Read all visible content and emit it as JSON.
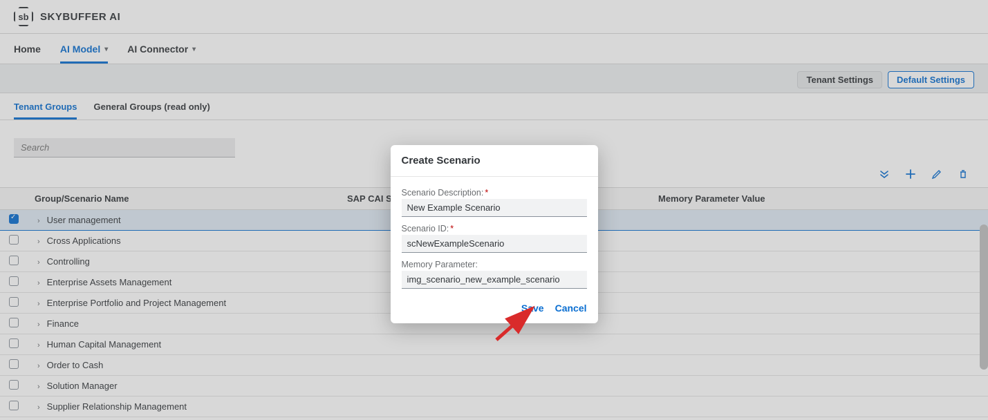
{
  "header": {
    "logo_text": "sb",
    "app_title": "SKYBUFFER AI"
  },
  "nav": {
    "home": "Home",
    "ai_model": "AI Model",
    "ai_connector": "AI Connector"
  },
  "settings_bar": {
    "tenant_settings": "Tenant Settings",
    "default_settings": "Default Settings"
  },
  "subtabs": {
    "tenant_groups": "Tenant Groups",
    "general_groups": "General Groups (read only)"
  },
  "search": {
    "placeholder": "Search"
  },
  "table": {
    "columns": {
      "name": "Group/Scenario Name",
      "sap": "SAP CAI Scen",
      "mem": "Memory Parameter Value"
    },
    "rows": [
      {
        "name": "User management",
        "checked": true
      },
      {
        "name": "Cross Applications",
        "checked": false
      },
      {
        "name": "Controlling",
        "checked": false
      },
      {
        "name": "Enterprise Assets Management",
        "checked": false
      },
      {
        "name": "Enterprise Portfolio and Project Management",
        "checked": false
      },
      {
        "name": "Finance",
        "checked": false
      },
      {
        "name": "Human Capital Management",
        "checked": false
      },
      {
        "name": "Order to Cash",
        "checked": false
      },
      {
        "name": "Solution Manager",
        "checked": false
      },
      {
        "name": "Supplier Relationship Management",
        "checked": false
      }
    ]
  },
  "dialog": {
    "title": "Create Scenario",
    "fields": {
      "desc_label": "Scenario Description:",
      "desc_value": "New Example Scenario",
      "id_label": "Scenario ID:",
      "id_value": "scNewExampleScenario",
      "mem_label": "Memory Parameter:",
      "mem_value": "img_scenario_new_example_scenario"
    },
    "buttons": {
      "save": "Save",
      "cancel": "Cancel"
    }
  },
  "colors": {
    "accent": "#0a6ed1",
    "arrow": "#d92b2b"
  }
}
